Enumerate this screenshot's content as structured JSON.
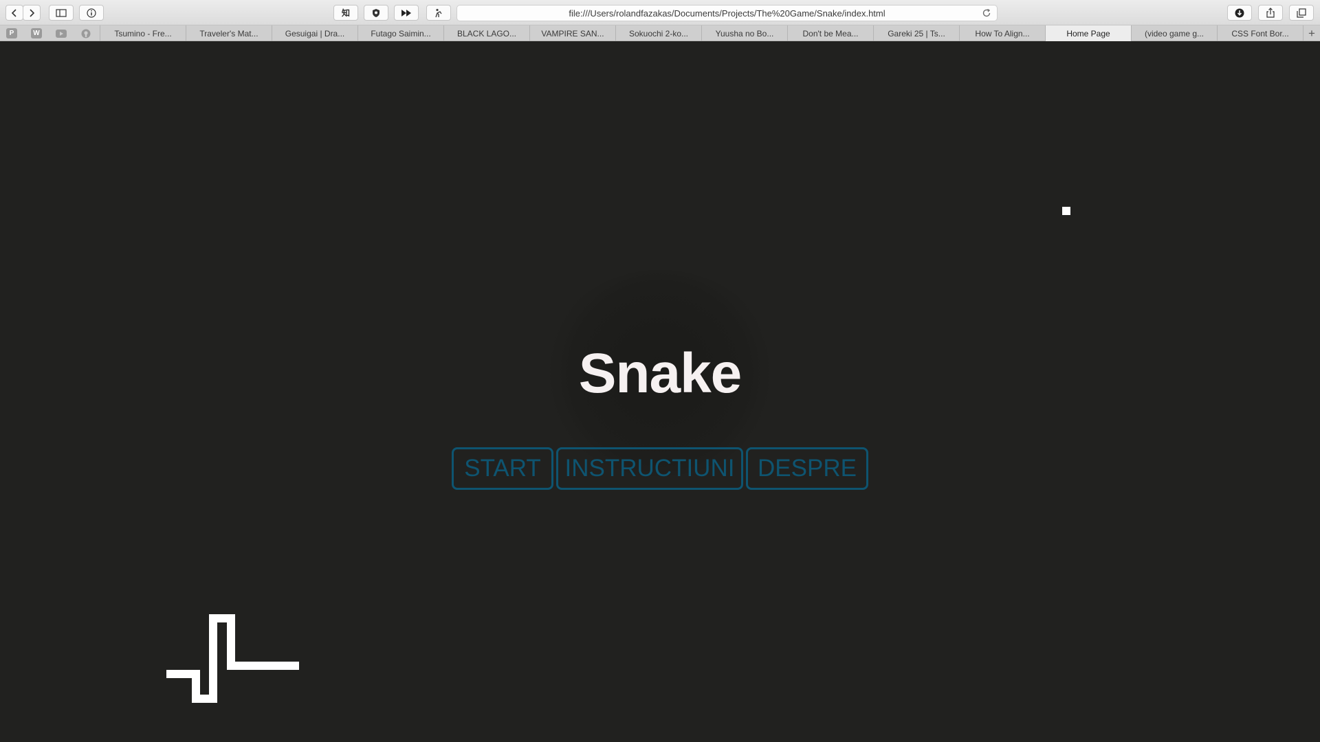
{
  "browser": {
    "url": "file:///Users/rolandfazakas/Documents/Projects/The%20Game/Snake/index.html",
    "toolbar_icons": [
      "back-icon",
      "forward-icon",
      "sidebar-icon",
      "info-icon",
      "translate-icon",
      "shield-icon",
      "fast-forward-icon",
      "extension-icon",
      "download-icon",
      "share-icon",
      "tabs-overview-icon"
    ],
    "translate_glyph": "知",
    "favorites": [
      {
        "label": "P",
        "name": "favorite-p-icon"
      },
      {
        "label": "W",
        "name": "favorite-w-icon"
      },
      {
        "label": "",
        "name": "youtube-icon"
      },
      {
        "label": "",
        "name": "github-icon"
      }
    ],
    "tabs": [
      {
        "label": "Tsumino - Fre..."
      },
      {
        "label": "Traveler's Mat..."
      },
      {
        "label": "Gesuigai | Dra..."
      },
      {
        "label": "Futago Saimin..."
      },
      {
        "label": "BLACK LAGO..."
      },
      {
        "label": "VAMPIRE SAN..."
      },
      {
        "label": "Sokuochi 2-ko..."
      },
      {
        "label": "Yuusha no Bo..."
      },
      {
        "label": "Don't be Mea..."
      },
      {
        "label": "Gareki 25 | Ts..."
      },
      {
        "label": "How To Align..."
      },
      {
        "label": "Home Page",
        "active": true
      },
      {
        "label": "(video game g..."
      },
      {
        "label": "CSS Font Bor..."
      }
    ],
    "new_tab_label": "+"
  },
  "game": {
    "title": "Snake",
    "buttons": {
      "start": "START",
      "instructions": "INSTRUCTIUNI",
      "about": "DESPRE"
    },
    "colors": {
      "background": "#21211f",
      "title": "#f6f1f1",
      "button": "#0e5470",
      "snake": "#ffffff",
      "food": "#ffffff"
    }
  }
}
